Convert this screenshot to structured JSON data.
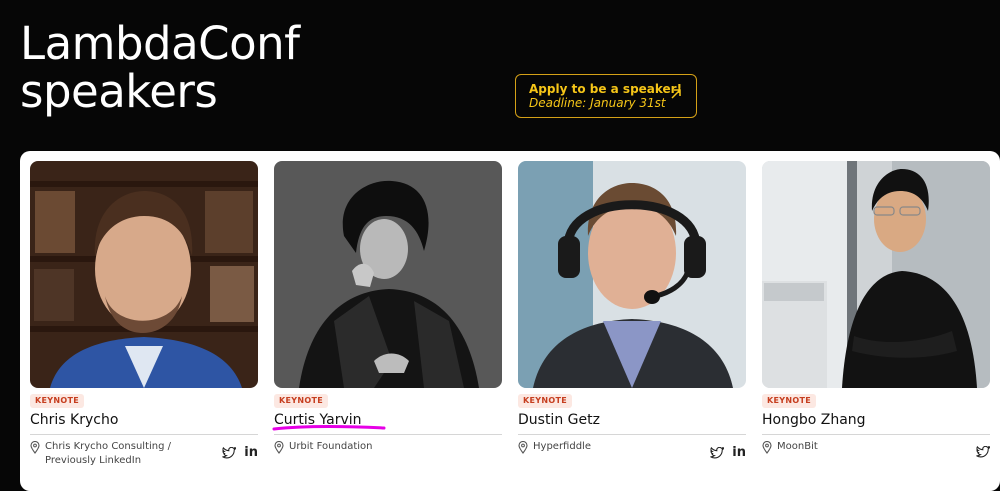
{
  "page": {
    "title_line1": "LambdaConf",
    "title_line2": "speakers"
  },
  "cta": {
    "title": "Apply to be a speaker!",
    "subtitle": "Deadline: January 31st",
    "icon": "arrow-up-right-icon"
  },
  "colors": {
    "background": "#060606",
    "accent": "#f5c518",
    "badge_text": "#c63e1f",
    "badge_bg": "#fce8e2",
    "annotation": "#e600e6"
  },
  "speakers": [
    {
      "badge": "KEYNOTE",
      "name": "Chris Krycho",
      "org": "Chris Krycho Consulting / Previously LinkedIn",
      "socials": [
        "twitter",
        "linkedin"
      ]
    },
    {
      "badge": "KEYNOTE",
      "name": "Curtis Yarvin",
      "org": "Urbit Foundation",
      "socials": []
    },
    {
      "badge": "KEYNOTE",
      "name": "Dustin Getz",
      "org": "Hyperfiddle",
      "socials": [
        "twitter",
        "linkedin"
      ]
    },
    {
      "badge": "KEYNOTE",
      "name": "Hongbo Zhang",
      "org": "MoonBit",
      "socials": [
        "twitter"
      ]
    }
  ]
}
